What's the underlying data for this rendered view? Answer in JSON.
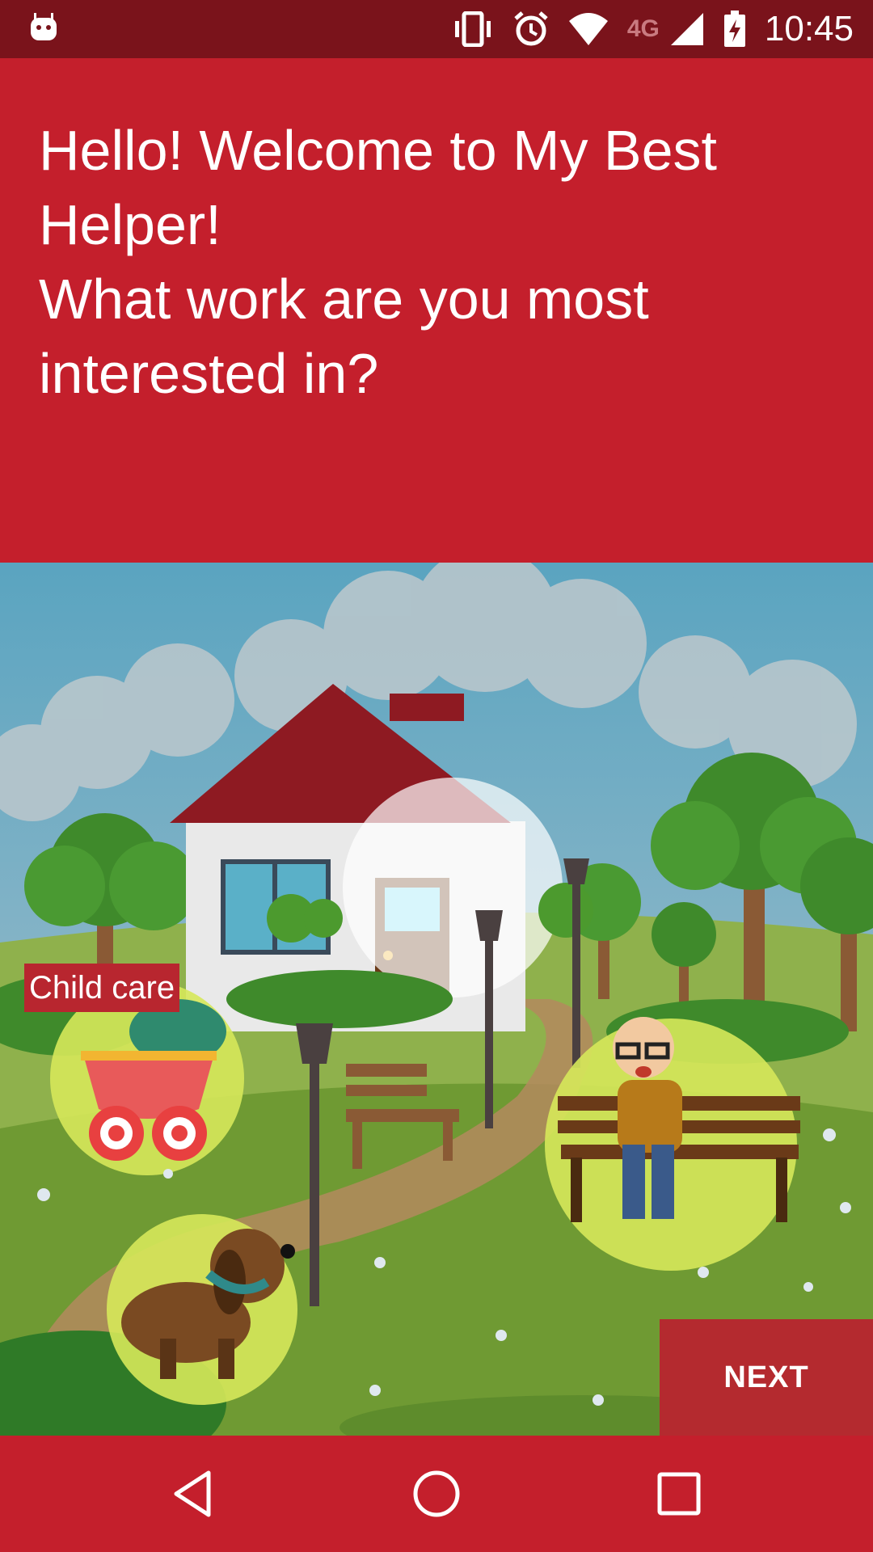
{
  "status_bar": {
    "time": "10:45",
    "network": "4G",
    "icons": [
      "android-notification-icon",
      "vibrate-icon",
      "alarm-icon",
      "wifi-icon",
      "signal-icon",
      "battery-charging-icon"
    ]
  },
  "header": {
    "lines": [
      "Hello! Welcome to My Best",
      "Helper!",
      "What work are you most",
      "interested in?"
    ]
  },
  "categories": {
    "child_care_label": "Child care"
  },
  "actions": {
    "next_label": "NEXT"
  },
  "navigation": {
    "icons": [
      "back-icon",
      "home-icon",
      "recents-icon"
    ]
  },
  "colors": {
    "primary": "#c41f2c",
    "status_bar": "#7a131b",
    "highlight": "#d6e85a"
  }
}
